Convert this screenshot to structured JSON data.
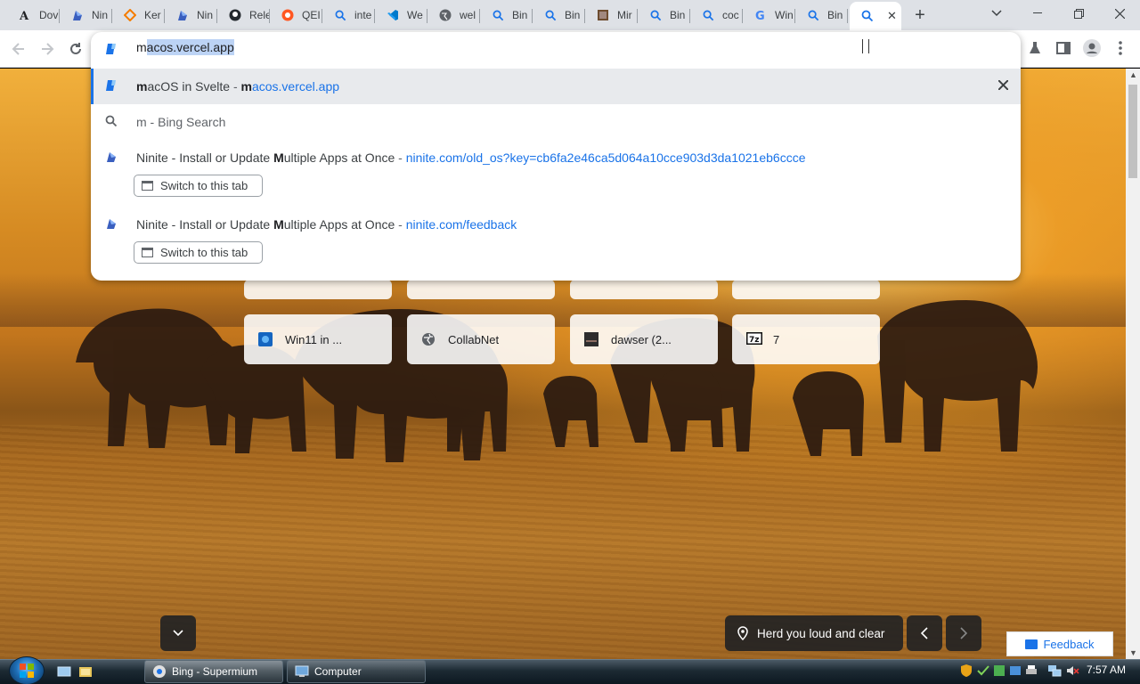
{
  "tabs": [
    {
      "label": "Dov",
      "icon": "font-a-icon"
    },
    {
      "label": "Nin",
      "icon": "ninite-icon"
    },
    {
      "label": "Ker",
      "icon": "orange-diamond-icon"
    },
    {
      "label": "Nin",
      "icon": "ninite-icon"
    },
    {
      "label": "Rele",
      "icon": "github-icon"
    },
    {
      "label": "QEI",
      "icon": "qemu-icon"
    },
    {
      "label": "inte",
      "icon": "search-icon"
    },
    {
      "label": "We",
      "icon": "vscode-icon"
    },
    {
      "label": "wel",
      "icon": "globe-icon"
    },
    {
      "label": "Bin",
      "icon": "search-icon"
    },
    {
      "label": "Bin",
      "icon": "search-icon"
    },
    {
      "label": "Mir",
      "icon": "box-icon"
    },
    {
      "label": "Bin",
      "icon": "search-icon"
    },
    {
      "label": "coc",
      "icon": "search-icon"
    },
    {
      "label": "Win",
      "icon": "google-icon"
    },
    {
      "label": "Bin",
      "icon": "search-icon"
    }
  ],
  "active_tab": {
    "icon": "search-icon",
    "close": "✕"
  },
  "new_tab": "+",
  "omnibox": {
    "typed": "m",
    "selected_completion": "acos.vercel.app",
    "suggestions": [
      {
        "bold": "m",
        "title_rest": "acOS in Svelte",
        "sep": " - ",
        "url_bold": "m",
        "url_rest": "acos.vercel.app"
      },
      {
        "text": "m - Bing Search"
      },
      {
        "title_pre": "Ninite - Install or Update ",
        "bold": "M",
        "title_rest": "ultiple Apps at Once",
        "sep": " - ",
        "url": "ninite.com/old_os?key=cb6fa2e46ca5d064a10cce903d3da1021eb6ccce",
        "button": "Switch to this tab"
      },
      {
        "title_pre": "Ninite - Install or Update ",
        "bold": "M",
        "title_rest": "ultiple Apps at Once",
        "sep": " - ",
        "url": "ninite.com/feedback",
        "button": "Switch to this tab"
      }
    ]
  },
  "shortcuts": [
    {
      "label": "Win11 in ...",
      "icon": "win11-icon"
    },
    {
      "label": "CollabNet",
      "icon": "globe-icon"
    },
    {
      "label": "dawser (2...",
      "icon": "terminal-icon"
    },
    {
      "label": "7",
      "icon": "7zip-icon"
    }
  ],
  "background": {
    "attribution": "Herd you loud and clear"
  },
  "feedback_label": "Feedback",
  "taskbar": {
    "items": [
      {
        "label": "Bing - Supermium",
        "active": true
      },
      {
        "label": "Computer",
        "active": false
      }
    ],
    "clock": "7:57 AM"
  },
  "colors": {
    "accent": "#1a73e8",
    "tabstrip": "#dee1e6"
  }
}
